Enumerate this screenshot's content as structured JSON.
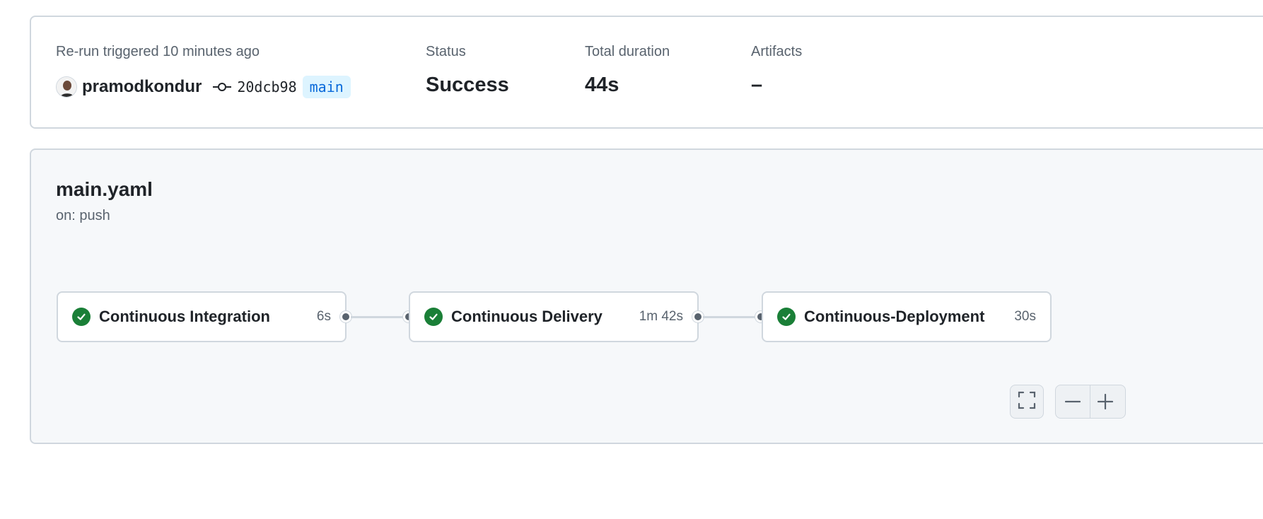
{
  "summary": {
    "trigger_text": "Re-run triggered 10 minutes ago",
    "username": "pramodkondur",
    "commit_sha": "20dcb98",
    "branch": "main",
    "status_label": "Status",
    "status_value": "Success",
    "duration_label": "Total duration",
    "duration_value": "44s",
    "artifacts_label": "Artifacts",
    "artifacts_value": "–"
  },
  "workflow": {
    "file": "main.yaml",
    "trigger": "on: push",
    "jobs": [
      {
        "name": "Continuous Integration",
        "duration": "6s",
        "status": "success"
      },
      {
        "name": "Continuous Delivery",
        "duration": "1m 42s",
        "status": "success"
      },
      {
        "name": "Continuous-Deployment",
        "duration": "30s",
        "status": "success"
      }
    ]
  },
  "controls": {
    "fullscreen_icon": "fullscreen-icon",
    "zoom_out_icon": "minus-icon",
    "zoom_in_icon": "plus-icon"
  },
  "colors": {
    "success": "#1a7f37",
    "branch_bg": "#ddf4ff",
    "branch_fg": "#0969da",
    "border": "#d0d7de",
    "panel_bg": "#f6f8fa"
  }
}
